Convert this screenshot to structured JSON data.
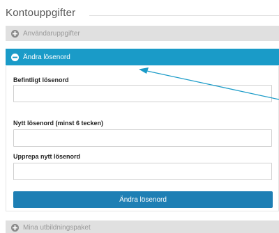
{
  "section": {
    "title": "Kontouppgifter"
  },
  "accordion": {
    "user_details": {
      "label": "Användaruppgifter",
      "state": "collapsed"
    },
    "change_password": {
      "label": "Ändra lösenord",
      "state": "expanded"
    },
    "packages": {
      "label": "Mina utbildningspaket",
      "state": "collapsed"
    }
  },
  "form": {
    "current_password": {
      "label": "Befintligt lösenord",
      "value": ""
    },
    "new_password": {
      "label": "Nytt lösenord (minst 6 tecken)",
      "value": ""
    },
    "repeat_password": {
      "label": "Upprepa nytt lösenord",
      "value": ""
    },
    "submit_label": "Ändra lösenord"
  },
  "colors": {
    "accent_header": "#1a9bc8",
    "button": "#1e7fb4",
    "collapsed_header": "#e0e0e0",
    "annotation_arrow": "#1a9bc8"
  },
  "icons": {
    "collapsed": "plus-circle-icon",
    "expanded": "minus-circle-icon",
    "annotation": "arrow-annotation"
  }
}
